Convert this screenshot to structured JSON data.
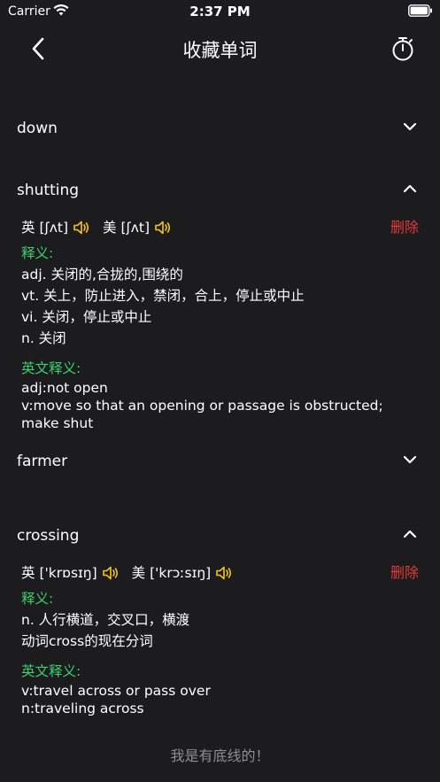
{
  "status_bar": {
    "carrier": "Carrier",
    "time": "2:37 PM"
  },
  "nav": {
    "title": "收藏单词",
    "back_icon": "chevron-left-icon",
    "timer_icon": "stopwatch-icon"
  },
  "colors": {
    "background": "#1c1c1e",
    "section_label": "#3bcf6e",
    "delete": "#e23b3b",
    "speaker": "#f5c518",
    "footer_text": "#8e8e93"
  },
  "words": [
    {
      "word": "down",
      "expanded": false
    },
    {
      "word": "shutting",
      "expanded": true,
      "uk_label": "英",
      "uk_phonetic": "[ʃʌt]",
      "us_label": "美",
      "us_phonetic": "[ʃʌt]",
      "delete_label": "删除",
      "cn_label": "释义:",
      "cn_defs": [
        "adj. 关闭的,合拢的,围绕的",
        "vt. 关上，防止进入，禁闭，合上，停止或中止",
        "vi. 关闭，停止或中止",
        "n. 关闭"
      ],
      "en_label": "英文释义:",
      "en_defs": [
        "adj:not open",
        "v:move so that an opening or passage is obstructed;",
        "make shut"
      ]
    },
    {
      "word": "farmer",
      "expanded": false
    },
    {
      "word": "crossing",
      "expanded": true,
      "uk_label": "英",
      "uk_phonetic": "['krɒsɪŋ]",
      "us_label": "美",
      "us_phonetic": "['krɔːsɪŋ]",
      "delete_label": "删除",
      "cn_label": "释义:",
      "cn_defs": [
        "n. 人行横道，交叉口，横渡",
        "动词cross的现在分词"
      ],
      "en_label": "英文释义:",
      "en_defs": [
        "v:travel across or pass over",
        "n:traveling across"
      ]
    }
  ],
  "footer": "我是有底线的！"
}
